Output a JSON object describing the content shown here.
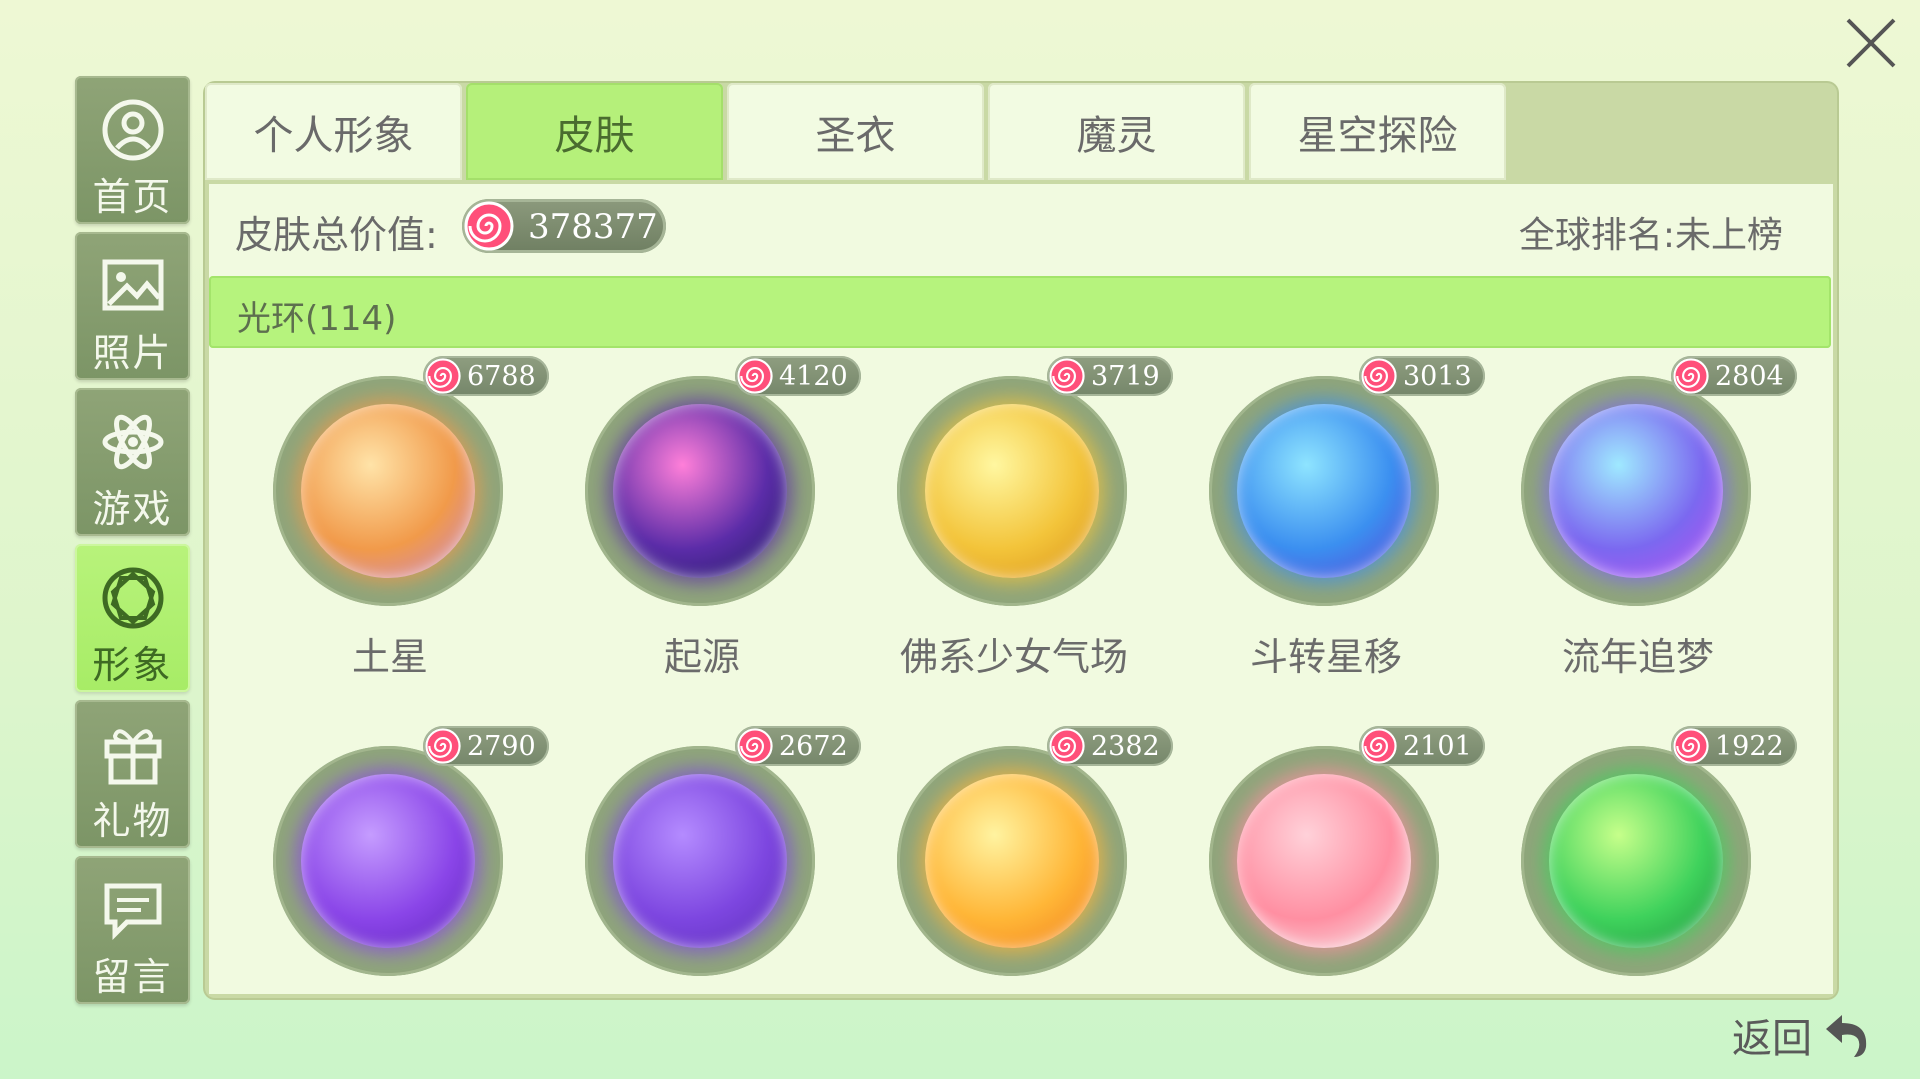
{
  "close_label": "close",
  "sidebar": {
    "items": [
      {
        "label": "首页",
        "icon": "profile-icon"
      },
      {
        "label": "照片",
        "icon": "photo-icon"
      },
      {
        "label": "游戏",
        "icon": "atom-icon"
      },
      {
        "label": "形象",
        "icon": "diamond-icon",
        "active": true
      },
      {
        "label": "礼物",
        "icon": "gift-icon"
      },
      {
        "label": "留言",
        "icon": "message-icon"
      }
    ]
  },
  "tabs": [
    {
      "label": "个人形象"
    },
    {
      "label": "皮肤",
      "active": true
    },
    {
      "label": "圣衣"
    },
    {
      "label": "魔灵"
    },
    {
      "label": "星空探险"
    }
  ],
  "summary": {
    "total_label": "皮肤总价值:",
    "total_value": "378377",
    "rank_text": "全球排名:未上榜"
  },
  "category": {
    "label": "光环(114)"
  },
  "items": [
    {
      "name": "土星",
      "price": "6788",
      "colors": [
        "#ffe3a8",
        "#f19a4a",
        "#c383d6"
      ]
    },
    {
      "name": "起源",
      "price": "4120",
      "colors": [
        "#ff7fd9",
        "#5b2ca8",
        "#1b1a5c"
      ]
    },
    {
      "name": "佛系少女气场",
      "price": "3719",
      "colors": [
        "#fff7a0",
        "#f3c43a",
        "#d88f17"
      ]
    },
    {
      "name": "斗转星移",
      "price": "3013",
      "colors": [
        "#8ee4ff",
        "#3b8ff0",
        "#5b3ed6"
      ]
    },
    {
      "name": "流年追梦",
      "price": "2804",
      "colors": [
        "#9fe9ff",
        "#7b68f0",
        "#c14df2"
      ]
    },
    {
      "name": "",
      "price": "2790",
      "colors": [
        "#c59cff",
        "#8a45e8",
        "#5b22b8"
      ]
    },
    {
      "name": "",
      "price": "2672",
      "colors": [
        "#b48bff",
        "#7d46e0",
        "#5a2db5"
      ]
    },
    {
      "name": "",
      "price": "2382",
      "colors": [
        "#fff3a0",
        "#ffb637",
        "#f07a1a"
      ]
    },
    {
      "name": "",
      "price": "2101",
      "colors": [
        "#ffd1d9",
        "#ff8fa2",
        "#f4f4f4"
      ]
    },
    {
      "name": "",
      "price": "1922",
      "colors": [
        "#c6ff8a",
        "#3fd25c",
        "#1a8d3b"
      ]
    }
  ],
  "back": {
    "label": "返回",
    "icon": "undo-arrow-icon"
  }
}
